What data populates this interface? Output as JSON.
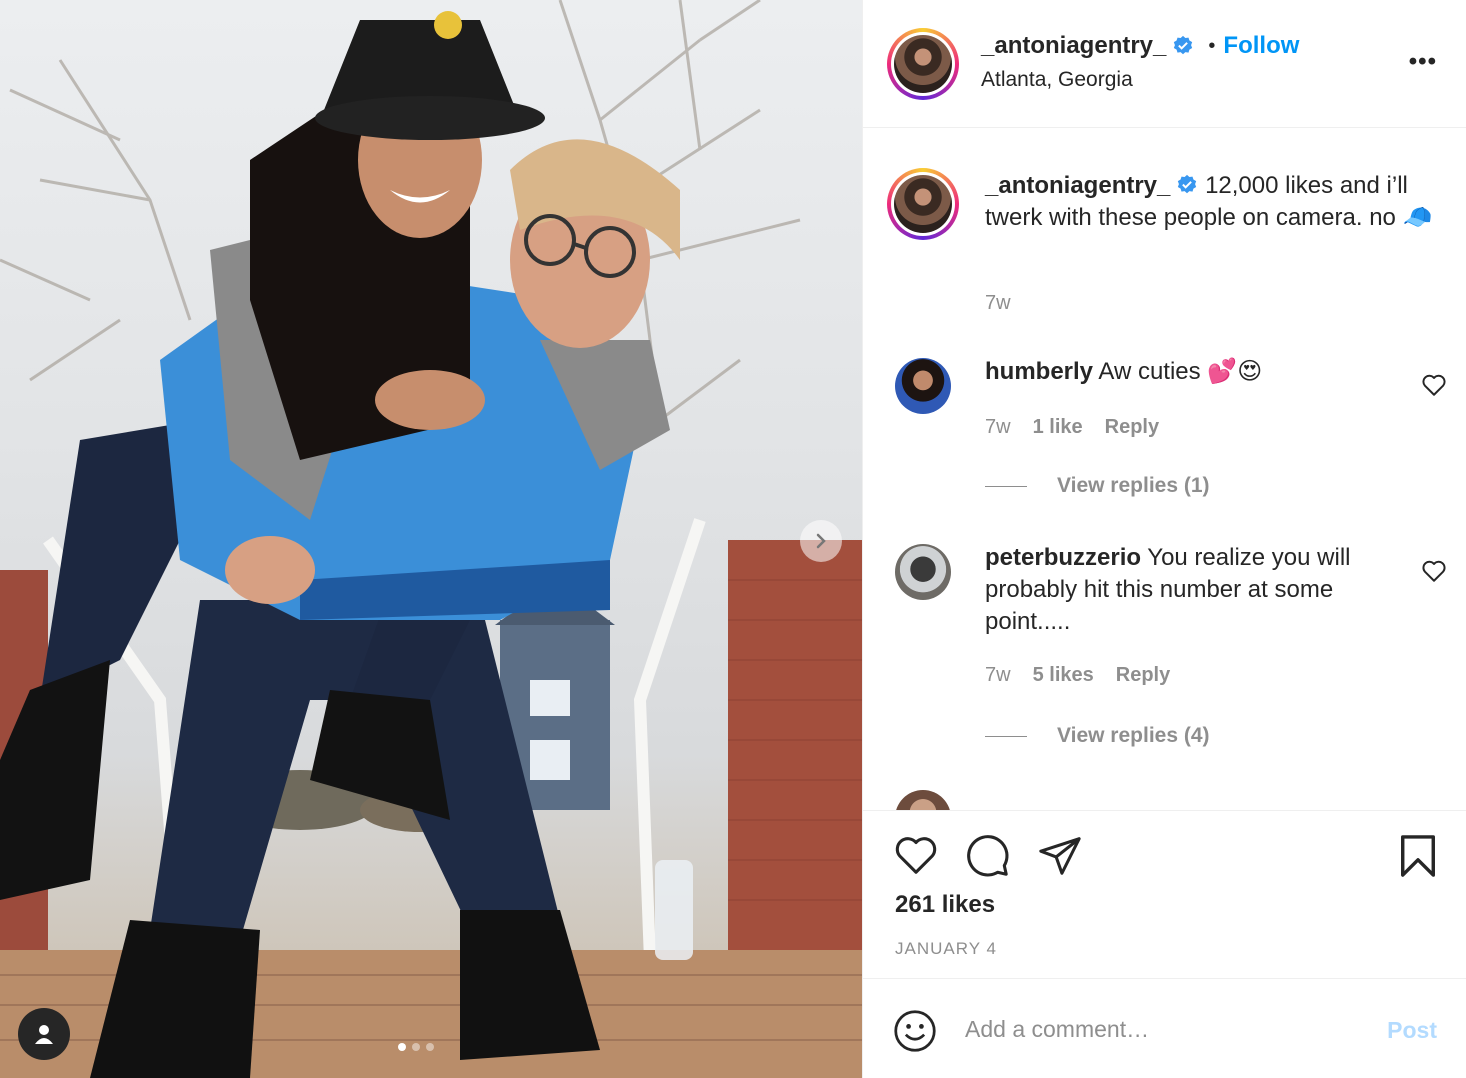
{
  "post": {
    "author": "_antoniagentry_",
    "location": "Atlanta, Georgia",
    "follow_label": "Follow",
    "dot": "•",
    "more_label": "•••",
    "caption_text": "12,000 likes and i’ll twerk with these people on camera. no 🧢",
    "caption_time": "7w",
    "likes": "261 likes",
    "date": "JANUARY 4"
  },
  "comments": [
    {
      "user": "humberly",
      "text": "Aw cuties 💕😍",
      "time": "7w",
      "likes": "1 like",
      "reply_label": "Reply",
      "view_replies": "View replies (1)"
    },
    {
      "user": "peterbuzzerio",
      "text": "You realize you will probably hit this number at some point.....",
      "time": "7w",
      "likes": "5 likes",
      "reply_label": "Reply",
      "view_replies": "View replies (4)"
    }
  ],
  "composer": {
    "placeholder": "Add a comment…",
    "post_label": "Post"
  },
  "carousel": {
    "dot_count": 3,
    "active_index": 0
  },
  "colors": {
    "accent": "#0095f6",
    "post_disabled": "#b3dbff",
    "muted": "#8e8e8e"
  },
  "icons": [
    "verified-badge-icon",
    "more-options-icon",
    "heart-icon",
    "comment-icon",
    "share-icon",
    "bookmark-icon",
    "emoji-icon",
    "next-arrow-icon",
    "user-tag-icon"
  ]
}
